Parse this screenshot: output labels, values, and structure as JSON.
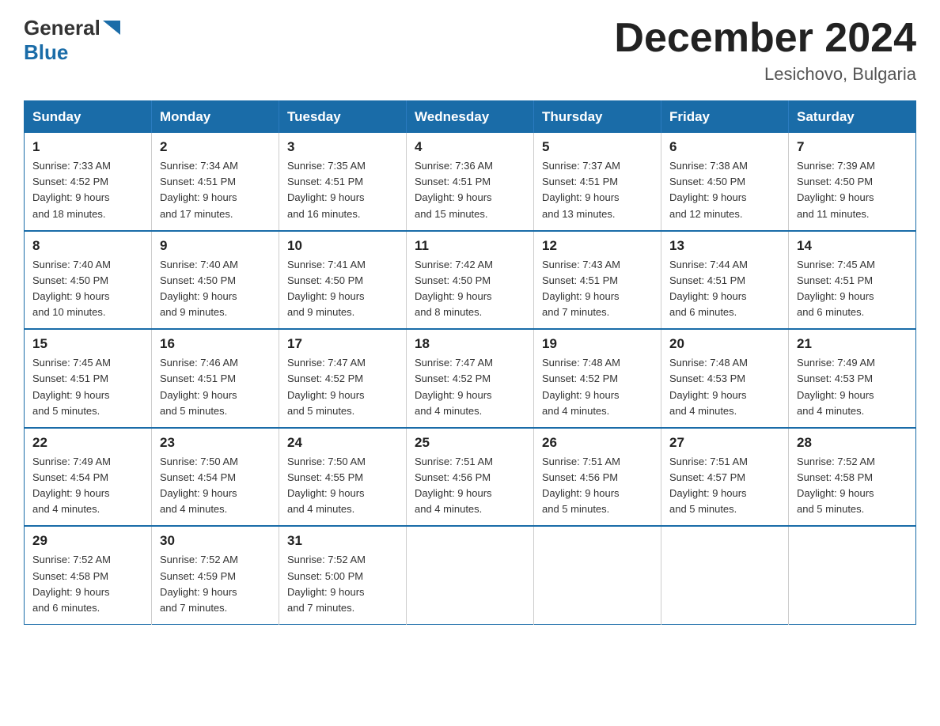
{
  "header": {
    "logo_general": "General",
    "logo_blue": "Blue",
    "month_title": "December 2024",
    "location": "Lesichovo, Bulgaria"
  },
  "days_of_week": [
    "Sunday",
    "Monday",
    "Tuesday",
    "Wednesday",
    "Thursday",
    "Friday",
    "Saturday"
  ],
  "weeks": [
    [
      {
        "day": "1",
        "sunrise": "7:33 AM",
        "sunset": "4:52 PM",
        "daylight": "9 hours and 18 minutes."
      },
      {
        "day": "2",
        "sunrise": "7:34 AM",
        "sunset": "4:51 PM",
        "daylight": "9 hours and 17 minutes."
      },
      {
        "day": "3",
        "sunrise": "7:35 AM",
        "sunset": "4:51 PM",
        "daylight": "9 hours and 16 minutes."
      },
      {
        "day": "4",
        "sunrise": "7:36 AM",
        "sunset": "4:51 PM",
        "daylight": "9 hours and 15 minutes."
      },
      {
        "day": "5",
        "sunrise": "7:37 AM",
        "sunset": "4:51 PM",
        "daylight": "9 hours and 13 minutes."
      },
      {
        "day": "6",
        "sunrise": "7:38 AM",
        "sunset": "4:50 PM",
        "daylight": "9 hours and 12 minutes."
      },
      {
        "day": "7",
        "sunrise": "7:39 AM",
        "sunset": "4:50 PM",
        "daylight": "9 hours and 11 minutes."
      }
    ],
    [
      {
        "day": "8",
        "sunrise": "7:40 AM",
        "sunset": "4:50 PM",
        "daylight": "9 hours and 10 minutes."
      },
      {
        "day": "9",
        "sunrise": "7:40 AM",
        "sunset": "4:50 PM",
        "daylight": "9 hours and 9 minutes."
      },
      {
        "day": "10",
        "sunrise": "7:41 AM",
        "sunset": "4:50 PM",
        "daylight": "9 hours and 9 minutes."
      },
      {
        "day": "11",
        "sunrise": "7:42 AM",
        "sunset": "4:50 PM",
        "daylight": "9 hours and 8 minutes."
      },
      {
        "day": "12",
        "sunrise": "7:43 AM",
        "sunset": "4:51 PM",
        "daylight": "9 hours and 7 minutes."
      },
      {
        "day": "13",
        "sunrise": "7:44 AM",
        "sunset": "4:51 PM",
        "daylight": "9 hours and 6 minutes."
      },
      {
        "day": "14",
        "sunrise": "7:45 AM",
        "sunset": "4:51 PM",
        "daylight": "9 hours and 6 minutes."
      }
    ],
    [
      {
        "day": "15",
        "sunrise": "7:45 AM",
        "sunset": "4:51 PM",
        "daylight": "9 hours and 5 minutes."
      },
      {
        "day": "16",
        "sunrise": "7:46 AM",
        "sunset": "4:51 PM",
        "daylight": "9 hours and 5 minutes."
      },
      {
        "day": "17",
        "sunrise": "7:47 AM",
        "sunset": "4:52 PM",
        "daylight": "9 hours and 5 minutes."
      },
      {
        "day": "18",
        "sunrise": "7:47 AM",
        "sunset": "4:52 PM",
        "daylight": "9 hours and 4 minutes."
      },
      {
        "day": "19",
        "sunrise": "7:48 AM",
        "sunset": "4:52 PM",
        "daylight": "9 hours and 4 minutes."
      },
      {
        "day": "20",
        "sunrise": "7:48 AM",
        "sunset": "4:53 PM",
        "daylight": "9 hours and 4 minutes."
      },
      {
        "day": "21",
        "sunrise": "7:49 AM",
        "sunset": "4:53 PM",
        "daylight": "9 hours and 4 minutes."
      }
    ],
    [
      {
        "day": "22",
        "sunrise": "7:49 AM",
        "sunset": "4:54 PM",
        "daylight": "9 hours and 4 minutes."
      },
      {
        "day": "23",
        "sunrise": "7:50 AM",
        "sunset": "4:54 PM",
        "daylight": "9 hours and 4 minutes."
      },
      {
        "day": "24",
        "sunrise": "7:50 AM",
        "sunset": "4:55 PM",
        "daylight": "9 hours and 4 minutes."
      },
      {
        "day": "25",
        "sunrise": "7:51 AM",
        "sunset": "4:56 PM",
        "daylight": "9 hours and 4 minutes."
      },
      {
        "day": "26",
        "sunrise": "7:51 AM",
        "sunset": "4:56 PM",
        "daylight": "9 hours and 5 minutes."
      },
      {
        "day": "27",
        "sunrise": "7:51 AM",
        "sunset": "4:57 PM",
        "daylight": "9 hours and 5 minutes."
      },
      {
        "day": "28",
        "sunrise": "7:52 AM",
        "sunset": "4:58 PM",
        "daylight": "9 hours and 5 minutes."
      }
    ],
    [
      {
        "day": "29",
        "sunrise": "7:52 AM",
        "sunset": "4:58 PM",
        "daylight": "9 hours and 6 minutes."
      },
      {
        "day": "30",
        "sunrise": "7:52 AM",
        "sunset": "4:59 PM",
        "daylight": "9 hours and 7 minutes."
      },
      {
        "day": "31",
        "sunrise": "7:52 AM",
        "sunset": "5:00 PM",
        "daylight": "9 hours and 7 minutes."
      },
      null,
      null,
      null,
      null
    ]
  ],
  "labels": {
    "sunrise": "Sunrise:",
    "sunset": "Sunset:",
    "daylight": "Daylight:"
  }
}
